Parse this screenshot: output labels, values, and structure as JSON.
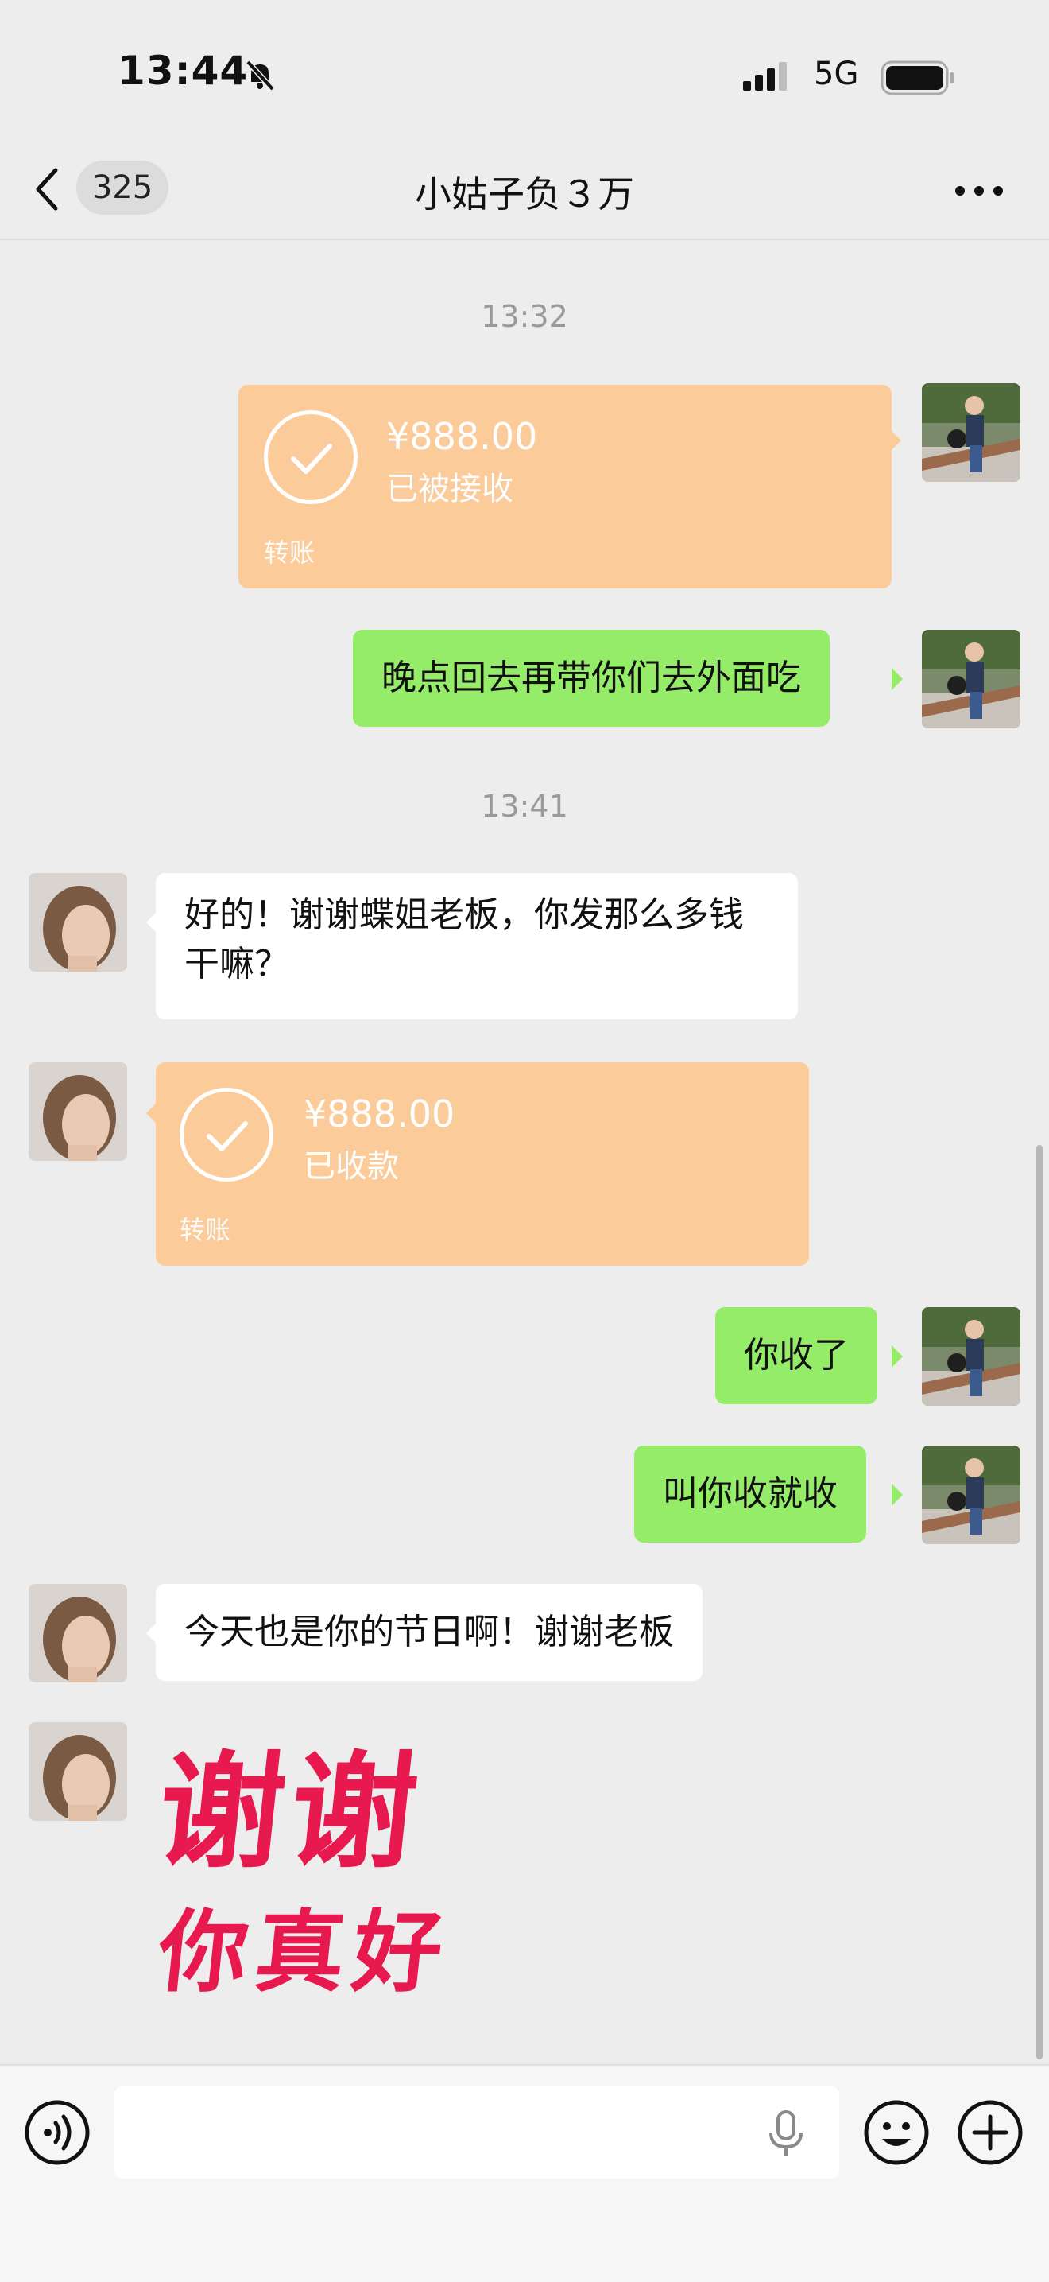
{
  "status_bar": {
    "time": "13:44",
    "network": "5G"
  },
  "header": {
    "back_count": "325",
    "title": "小姑子负３万"
  },
  "messages": {
    "ts1": "13:32",
    "transfer1": {
      "amount": "¥888.00",
      "status": "已被接收",
      "label": "转账"
    },
    "msg1": "晚点回去再带你们去外面吃",
    "ts2": "13:41",
    "msg2_line1": "好的！谢谢蝶姐老板，你发那么多钱",
    "msg2_line2": "干嘛？",
    "transfer2": {
      "amount": "¥888.00",
      "status": "已收款",
      "label": "转账"
    },
    "msg3": "你收了",
    "msg4": "叫你收就收",
    "msg5": "今天也是你的节日啊！谢谢老板",
    "sticker_line1": "谢谢",
    "sticker_line2": "你真好"
  },
  "colors": {
    "green_bubble": "#95ec69",
    "transfer_orange": "#fbcb9a",
    "sticker_red": "#e8194f"
  },
  "icons": [
    "bell-off-icon",
    "signal-icon",
    "battery-icon",
    "back-icon",
    "more-icon",
    "voice-icon",
    "mic-icon",
    "emoji-icon",
    "plus-icon"
  ]
}
